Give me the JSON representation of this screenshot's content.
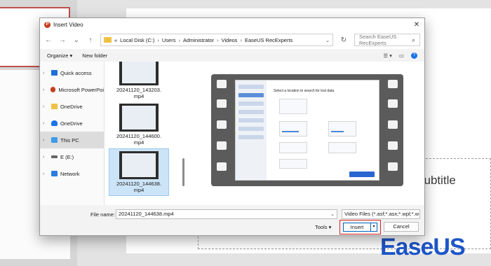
{
  "background": {
    "slide_text": "subtitle",
    "brand": "EaseUS",
    "brand_color": "#1e56c8"
  },
  "dialog": {
    "title": "Insert Video",
    "close_glyph": "✕",
    "nav": {
      "back": "←",
      "forward": "→",
      "up": "↑",
      "refresh": "↻",
      "dropdown": "⌄"
    },
    "address": {
      "prefix": "«",
      "crumbs": [
        "Local Disk (C:)",
        "Users",
        "Administrator",
        "Videos",
        "EaseUS RecExperts"
      ],
      "sep": "›"
    },
    "search_placeholder": "Search EaseUS RecExperts",
    "toolbar": {
      "organize": "Organize ▾",
      "new_folder": "New folder",
      "view": "☰ ▾",
      "pane": "▭",
      "help": "?"
    },
    "nav_pane": [
      {
        "label": "Quick access",
        "icon": "star-icon",
        "chevron": "›"
      },
      {
        "label": "Microsoft PowerPoi",
        "icon": "powerpoint-icon",
        "chevron": "›"
      },
      {
        "label": "OneDrive",
        "icon": "folder-icon",
        "chevron": "›"
      },
      {
        "label": "OneDrive",
        "icon": "cloud-icon",
        "chevron": "›"
      },
      {
        "label": "This PC",
        "icon": "pc-icon",
        "chevron": "›",
        "selected": true
      },
      {
        "label": "E (E:)",
        "icon": "drive-icon",
        "chevron": "›"
      },
      {
        "label": "Network",
        "icon": "network-icon",
        "chevron": "›"
      }
    ],
    "files": [
      {
        "name_line1": "20241120_143203.",
        "name_line2": "mp4"
      },
      {
        "name_line1": "20241120_144600.",
        "name_line2": "mp4"
      },
      {
        "name_line1": "20241120_144638.",
        "name_line2": "mp4",
        "selected": true
      }
    ],
    "file_name_label": "File name:",
    "file_name_value": "20241120_144638.mp4",
    "file_type": "Video Files (*.asf;*.asx;*.wpl;*.w",
    "tools": "Tools ▾",
    "insert": "Insert",
    "insert_drop": "▾",
    "cancel": "Cancel",
    "preview": {
      "title": "Select a location to search for lost data",
      "sidebar_items": 7,
      "highlight_color": "#d7251b"
    }
  }
}
